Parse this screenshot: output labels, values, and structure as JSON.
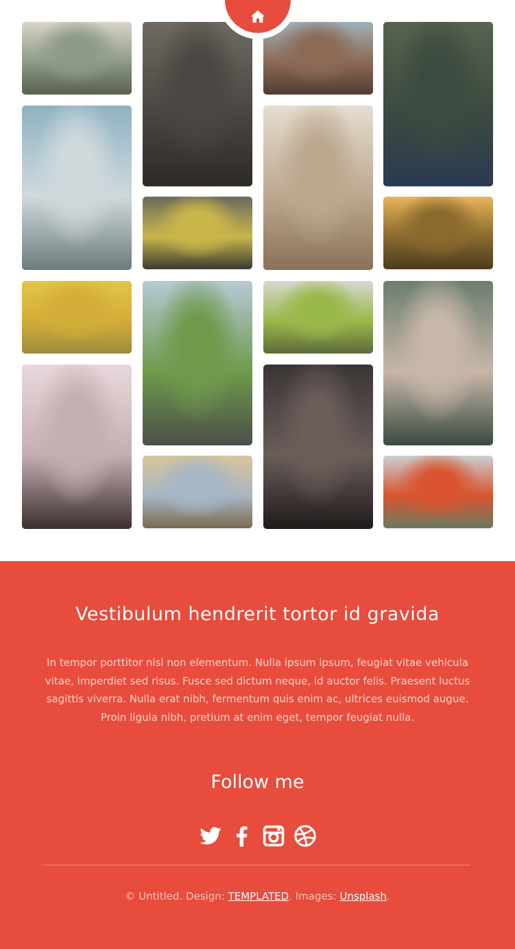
{
  "nav": {
    "home_icon": "home-icon"
  },
  "gallery": {
    "tiles": [
      {
        "name": "photo-woman-hill",
        "colors": [
          "#d9d4c8",
          "#8e9a8a",
          "#58604f"
        ]
      },
      {
        "name": "photo-woman-portrait-redlips",
        "colors": [
          "#6f6a63",
          "#4b4641",
          "#2d2925"
        ]
      },
      {
        "name": "photo-woman-canyon",
        "colors": [
          "#9fb0b9",
          "#8c6a55",
          "#4f3e33"
        ]
      },
      {
        "name": "photo-woman-flowers-bouquet",
        "colors": [
          "#56634f",
          "#3c4a40",
          "#2a3a52"
        ]
      },
      {
        "name": "photo-woman-car-parking",
        "colors": [
          "#8fb1c3",
          "#cfd9dc",
          "#6e7b7d"
        ]
      },
      {
        "name": "photo-woman-sand-beach",
        "colors": [
          "#e6ddd0",
          "#bba88f",
          "#8a7157"
        ]
      },
      {
        "name": "photo-woman-tunnel-graffiti",
        "colors": [
          "#6a6a5c",
          "#c9b64a",
          "#3c3a33"
        ]
      },
      {
        "name": "photo-woman-sunflower",
        "colors": [
          "#e7b45a",
          "#8a6a2e",
          "#4b3c1f"
        ]
      },
      {
        "name": "photo-woman-yellow-wall",
        "colors": [
          "#e3c447",
          "#d2ad38",
          "#9d8a3c"
        ]
      },
      {
        "name": "photo-woman-park-hands-face",
        "colors": [
          "#b6c9d6",
          "#6f9a4c",
          "#4c4f4a"
        ]
      },
      {
        "name": "photo-woman-green-van",
        "colors": [
          "#d7d8cf",
          "#9ab84a",
          "#5f6b3b"
        ]
      },
      {
        "name": "photo-woman-conical-hat-lotus",
        "colors": [
          "#6c7d6f",
          "#c7b7a8",
          "#3a4b42"
        ]
      },
      {
        "name": "photo-woman-blossom-portrait",
        "colors": [
          "#e9d9dc",
          "#c3aeb2",
          "#3b2f2f"
        ]
      },
      {
        "name": "photo-woman-headscarf",
        "colors": [
          "#3a3535",
          "#6a5d5a",
          "#1f1b1b"
        ]
      },
      {
        "name": "photo-woman-field-sunset",
        "colors": [
          "#d9c49a",
          "#a7b6c5",
          "#7a6a4e"
        ]
      },
      {
        "name": "photo-woman-red-jacket",
        "colors": [
          "#c9cfd1",
          "#d9542f",
          "#6a7a62"
        ]
      }
    ]
  },
  "footer": {
    "title": "Vestibulum hendrerit tortor id gravida",
    "body": "In tempor porttitor nisl non elementum. Nulla ipsum ipsum, feugiat vitae vehicula vitae, imperdiet sed risus. Fusce sed dictum neque, id auctor felis. Praesent luctus sagittis viverra. Nulla erat nibh, fermentum quis enim ac, ultrices euismod augue. Proin ligula nibh, pretium at enim eget, tempor feugiat nulla.",
    "follow_title": "Follow me",
    "social": [
      "twitter-icon",
      "facebook-icon",
      "instagram-icon",
      "dribbble-icon"
    ],
    "copyright_prefix": "© Untitled. Design: ",
    "design_link": "TEMPLATED",
    "images_prefix": ". Images: ",
    "images_link": "Unsplash",
    "end": "."
  },
  "colors": {
    "accent": "#e74c3c"
  }
}
